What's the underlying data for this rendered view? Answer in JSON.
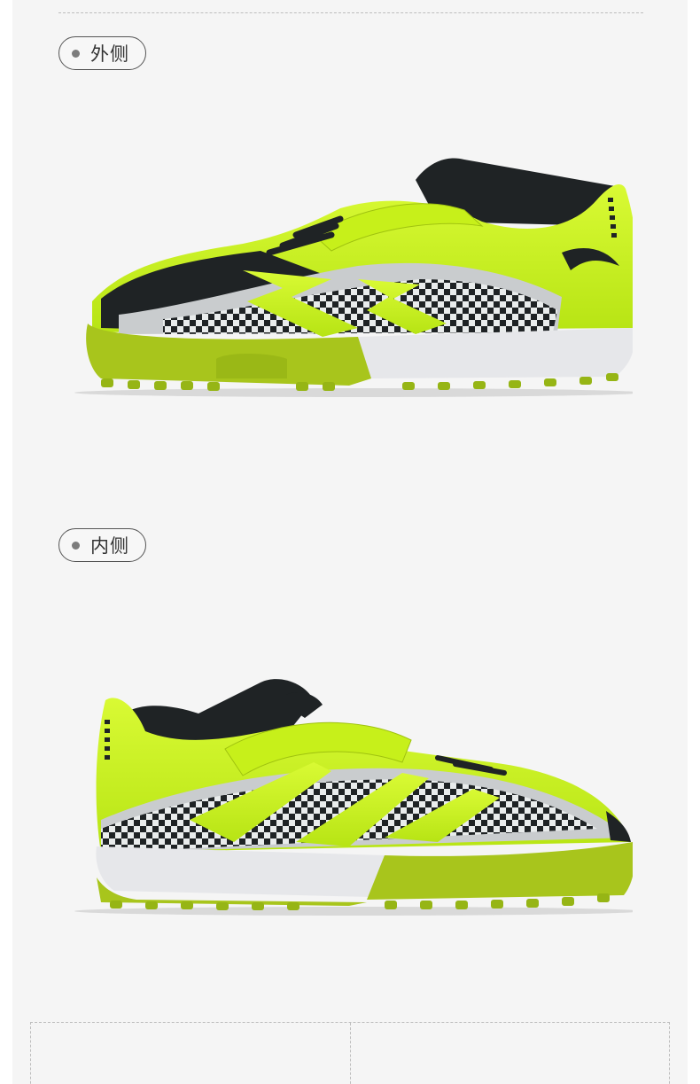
{
  "views": {
    "outer": {
      "label": "外侧"
    },
    "inner": {
      "label": "内侧"
    }
  },
  "colors": {
    "upper_lime": "#c9f31a",
    "sole_lime": "#a8c51c",
    "black": "#1f2325",
    "silver": "#c9ccce",
    "midsole_white": "#e6e7ea",
    "background": "#f5f5f5"
  },
  "icons": {
    "label_bullet": "dot-icon",
    "brand_logo": "brand-logo-icon"
  }
}
